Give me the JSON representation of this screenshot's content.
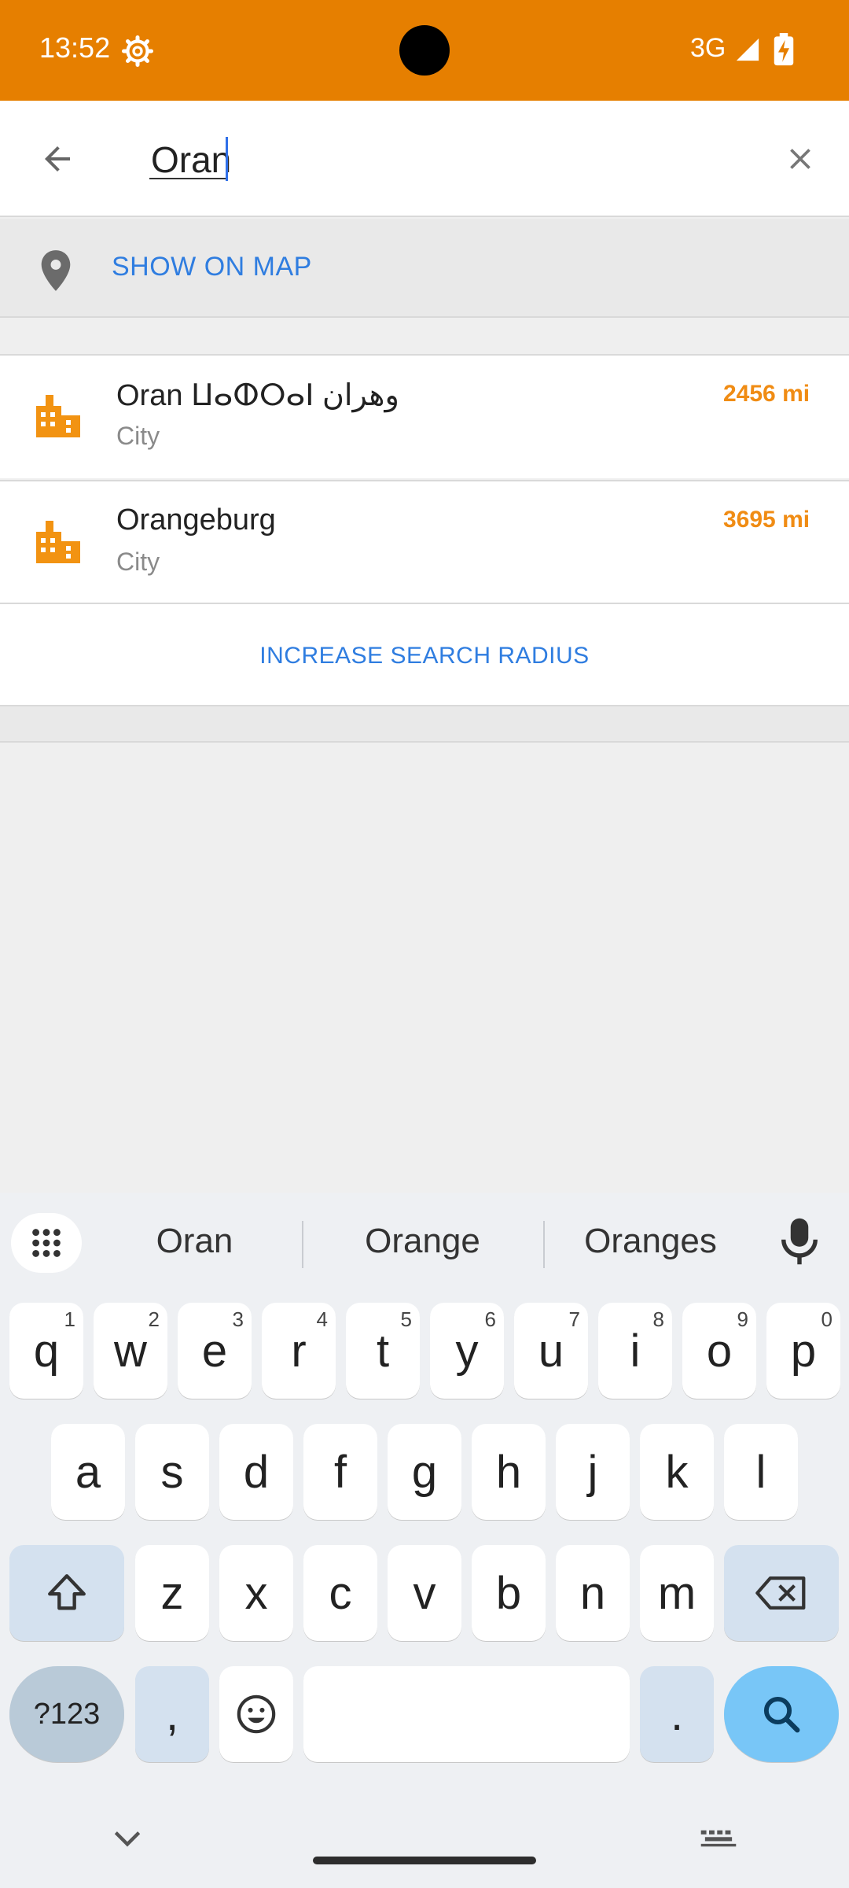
{
  "status_bar": {
    "time": "13:52",
    "network": "3G",
    "icons": [
      "settings-gear-icon",
      "signal-icon",
      "battery-charging-icon"
    ],
    "color": "#e67f00"
  },
  "search": {
    "value": "Oran",
    "icons": [
      "back-arrow-icon",
      "clear-x-icon"
    ]
  },
  "show_on_map": {
    "label": "SHOW ON MAP",
    "icon": "map-pin-icon"
  },
  "results": [
    {
      "name": "Oran ⵡⴰⵀⵔⴰⵏ وهران",
      "type": "City",
      "distance": "2456 mi",
      "icon": "city-building-icon"
    },
    {
      "name": "Orangeburg",
      "type": "City",
      "distance": "3695 mi",
      "icon": "city-building-icon"
    }
  ],
  "increase_radius": {
    "label": "INCREASE SEARCH RADIUS"
  },
  "keyboard": {
    "suggestions": [
      "Oran",
      "Orange",
      "Oranges"
    ],
    "row1": [
      {
        "k": "q",
        "h": "1"
      },
      {
        "k": "w",
        "h": "2"
      },
      {
        "k": "e",
        "h": "3"
      },
      {
        "k": "r",
        "h": "4"
      },
      {
        "k": "t",
        "h": "5"
      },
      {
        "k": "y",
        "h": "6"
      },
      {
        "k": "u",
        "h": "7"
      },
      {
        "k": "i",
        "h": "8"
      },
      {
        "k": "o",
        "h": "9"
      },
      {
        "k": "p",
        "h": "0"
      }
    ],
    "row2": [
      "a",
      "s",
      "d",
      "f",
      "g",
      "h",
      "j",
      "k",
      "l"
    ],
    "row3": [
      "z",
      "x",
      "c",
      "v",
      "b",
      "n",
      "m"
    ],
    "symbols_label": "?123",
    "comma": ",",
    "period": ".",
    "accent": "#78c6f7"
  }
}
